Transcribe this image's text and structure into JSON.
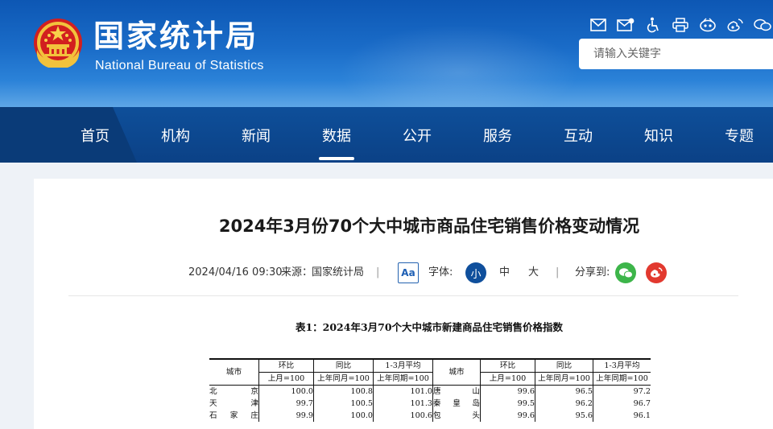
{
  "header": {
    "site_name_cn": "国家统计局",
    "site_name_en": "National Bureau of Statistics",
    "search_placeholder": "请输入关键字",
    "tool_icons": [
      "mail-icon",
      "message-icon",
      "accessibility-icon",
      "print-icon",
      "weibo-like-icon",
      "weibo-icon",
      "wechat-icon"
    ]
  },
  "nav": {
    "items": [
      "首页",
      "机构",
      "新闻",
      "数据",
      "公开",
      "服务",
      "互动",
      "知识",
      "专题"
    ],
    "active": "数据"
  },
  "article": {
    "title": "2024年3月份70个大中城市商品住宅销售价格变动情况",
    "datetime": "2024/04/16 09:30",
    "source_label": "来源：",
    "source": "国家统计局",
    "sep": "|",
    "aa": "Aa",
    "font_label": "字体:",
    "font_sizes": [
      "小",
      "中",
      "大"
    ],
    "share_label": "分享到:"
  },
  "table": {
    "caption": "表1：2024年3月70个大中城市新建商品住宅销售价格指数",
    "city_header": "城市",
    "groups": [
      "环比",
      "同比",
      "1-3月平均"
    ],
    "bases": [
      "上月=100",
      "上年同月=100",
      "上年同期=100"
    ],
    "rows": [
      [
        "北京",
        "100.0",
        "100.8",
        "101.0",
        "唐山",
        "99.6",
        "96.5",
        "97.2"
      ],
      [
        "天津",
        "99.7",
        "100.5",
        "101.3",
        "秦皇岛",
        "99.5",
        "96.2",
        "96.7"
      ],
      [
        "石家庄",
        "99.9",
        "100.0",
        "100.6",
        "包头",
        "99.6",
        "95.6",
        "96.1"
      ]
    ]
  },
  "colors": {
    "header_blue": "#1a6cc8",
    "nav_blue": "#0b4186",
    "accent": "#0f4f9c",
    "wechat_green": "#3db54a",
    "weibo_red": "#e2392f"
  }
}
